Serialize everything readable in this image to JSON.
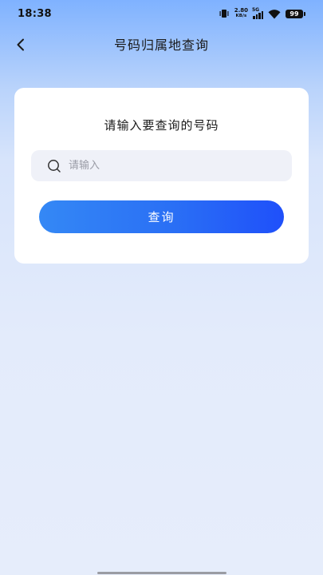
{
  "status_bar": {
    "time": "18:38",
    "net_speed_value": "2.80",
    "net_speed_unit": "KB/s",
    "signal_label": "5G",
    "battery": "99"
  },
  "nav": {
    "back_icon": "chevron-left-icon",
    "title": "号码归属地查询"
  },
  "card": {
    "title": "请输入要查询的号码",
    "search": {
      "icon": "search-icon",
      "placeholder": "请输入",
      "value": ""
    },
    "query_button_label": "查询"
  },
  "colors": {
    "accent_start": "#3488f5",
    "accent_end": "#1f50fa",
    "card_bg": "#ffffff",
    "input_bg": "#eff1f8"
  }
}
